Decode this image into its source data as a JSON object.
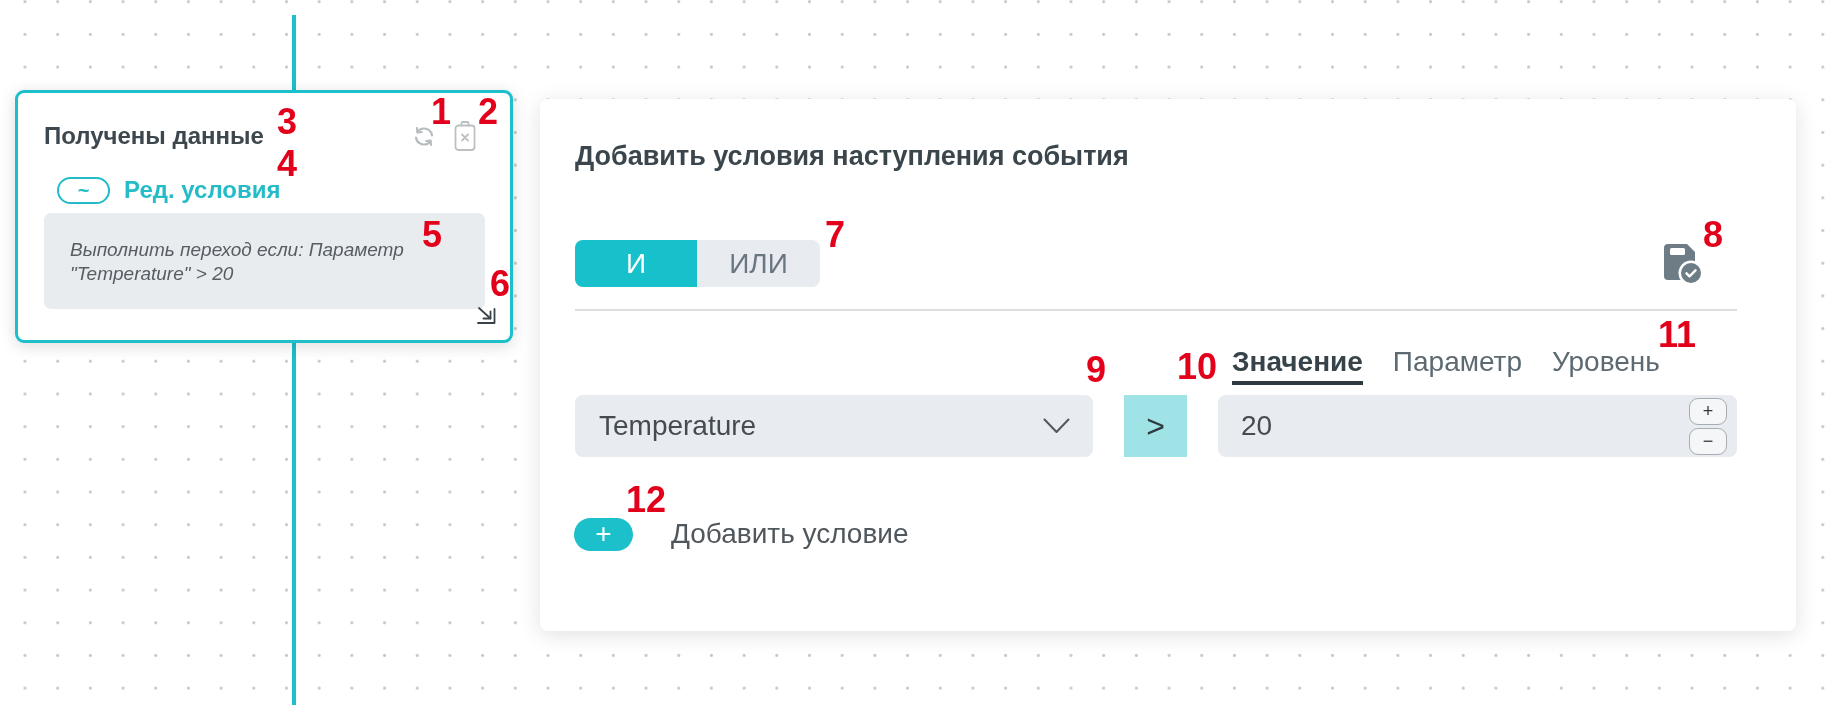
{
  "flow_node": {
    "title": {
      "text": "Получены данные",
      "callout": "3"
    },
    "refresh_button": {
      "callout": "1"
    },
    "delete_button": {
      "callout": "2"
    },
    "edit_conditions": {
      "toggle": "~",
      "label": "Ред. условия",
      "callout": "4"
    },
    "condition_summary": {
      "text": "Выполнить переход если: Параметр \"Temperature\" > 20",
      "callout": "5"
    },
    "resize_handle": {
      "callout": "6"
    }
  },
  "conditions_panel": {
    "title": "Добавить условия наступления события",
    "logic_toggle": {
      "options": [
        {
          "label": "И",
          "selected": true
        },
        {
          "label": "ИЛИ",
          "selected": false
        }
      ],
      "callout": "7"
    },
    "save_button": {
      "callout": "8"
    },
    "condition": {
      "parameter": {
        "value": "Temperature",
        "callout": "9"
      },
      "operator": {
        "label": ">",
        "callout": "10"
      },
      "value_source_tabs": {
        "tabs": [
          {
            "label": "Значение",
            "selected": true
          },
          {
            "label": "Параметр",
            "selected": false
          },
          {
            "label": "Уровень",
            "selected": false
          }
        ],
        "callout": "11"
      },
      "value": {
        "value": "20",
        "increment": "+",
        "decrement": "−"
      }
    },
    "add_condition": {
      "button": "+",
      "label": "Добавить условие",
      "callout": "12"
    }
  }
}
